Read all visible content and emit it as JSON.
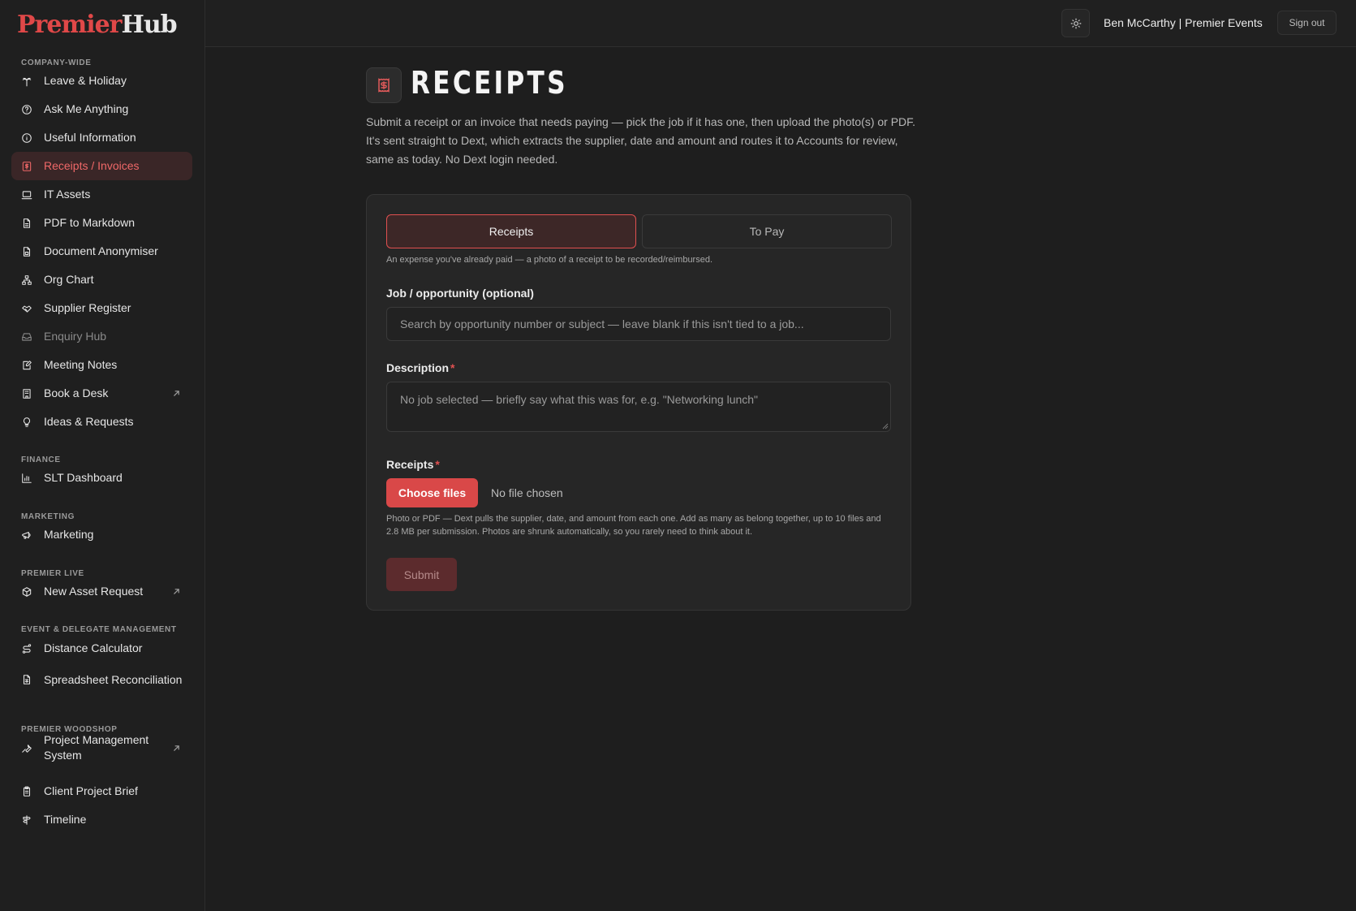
{
  "brand": {
    "part1": "Premier",
    "part2": "Hub"
  },
  "header": {
    "user": "Ben McCarthy | Premier Events",
    "signout_label": "Sign out"
  },
  "sidebar": {
    "sections": [
      {
        "label": "COMPANY-WIDE",
        "items": [
          {
            "label": "Leave & Holiday",
            "icon": "palm-tree-icon"
          },
          {
            "label": "Ask Me Anything",
            "icon": "help-circle-icon"
          },
          {
            "label": "Useful Information",
            "icon": "info-icon"
          },
          {
            "label": "Receipts / Invoices",
            "icon": "receipt-icon",
            "active": true
          },
          {
            "label": "IT Assets",
            "icon": "laptop-icon"
          },
          {
            "label": "PDF to Markdown",
            "icon": "file-text-icon"
          },
          {
            "label": "Document Anonymiser",
            "icon": "file-lock-icon"
          },
          {
            "label": "Org Chart",
            "icon": "org-chart-icon"
          },
          {
            "label": "Supplier Register",
            "icon": "handshake-icon"
          },
          {
            "label": "Enquiry Hub",
            "icon": "inbox-icon",
            "muted": true
          },
          {
            "label": "Meeting Notes",
            "icon": "notebook-pen-icon"
          },
          {
            "label": "Book a Desk",
            "icon": "building-icon",
            "external": true
          },
          {
            "label": "Ideas & Requests",
            "icon": "lightbulb-icon"
          }
        ]
      },
      {
        "label": "FINANCE",
        "items": [
          {
            "label": "SLT Dashboard",
            "icon": "bar-chart-icon"
          }
        ]
      },
      {
        "label": "MARKETING",
        "items": [
          {
            "label": "Marketing",
            "icon": "megaphone-icon"
          }
        ]
      },
      {
        "label": "PREMIER LIVE",
        "items": [
          {
            "label": "New Asset Request",
            "icon": "package-plus-icon",
            "external": true
          }
        ]
      },
      {
        "label": "EVENT & DELEGATE MANAGEMENT",
        "items": [
          {
            "label": "Distance Calculator",
            "icon": "route-icon"
          },
          {
            "label": "Spreadsheet Reconciliation",
            "icon": "spreadsheet-icon"
          }
        ]
      },
      {
        "label": "PREMIER WOODSHOP",
        "items": [
          {
            "label": "Project Management System",
            "icon": "wrench-icon",
            "external": true
          },
          {
            "label": "Client Project Brief",
            "icon": "clipboard-icon"
          },
          {
            "label": "Timeline",
            "icon": "signpost-icon"
          }
        ]
      }
    ]
  },
  "page": {
    "title": "RECEIPTS",
    "intro": "Submit a receipt or an invoice that needs paying — pick the job if it has one, then upload the photo(s) or PDF. It's sent straight to Dext, which extracts the supplier, date and amount and routes it to Accounts for review, same as today. No Dext login needed."
  },
  "form": {
    "tabs": [
      {
        "label": "Receipts",
        "active": true
      },
      {
        "label": "To Pay",
        "active": false
      }
    ],
    "tab_hint": "An expense you've already paid — a photo of a receipt to be recorded/reimbursed.",
    "job": {
      "label": "Job / opportunity (optional)",
      "placeholder": "Search by opportunity number or subject — leave blank if this isn't tied to a job..."
    },
    "description": {
      "label": "Description",
      "required_mark": "*",
      "placeholder": "No job selected — briefly say what this was for, e.g. \"Networking lunch\""
    },
    "receipts": {
      "label": "Receipts",
      "required_mark": "*",
      "choose_label": "Choose files",
      "no_file": "No file chosen",
      "help": "Photo or PDF — Dext pulls the supplier, date, and amount from each one. Add as many as belong together, up to 10 files and 2.8 MB per submission. Photos are shrunk automatically, so you rarely need to think about it."
    },
    "submit_label": "Submit"
  },
  "colors": {
    "accent": "#d94848",
    "active_bg": "#3a2627",
    "background": "#1e1e1e"
  }
}
